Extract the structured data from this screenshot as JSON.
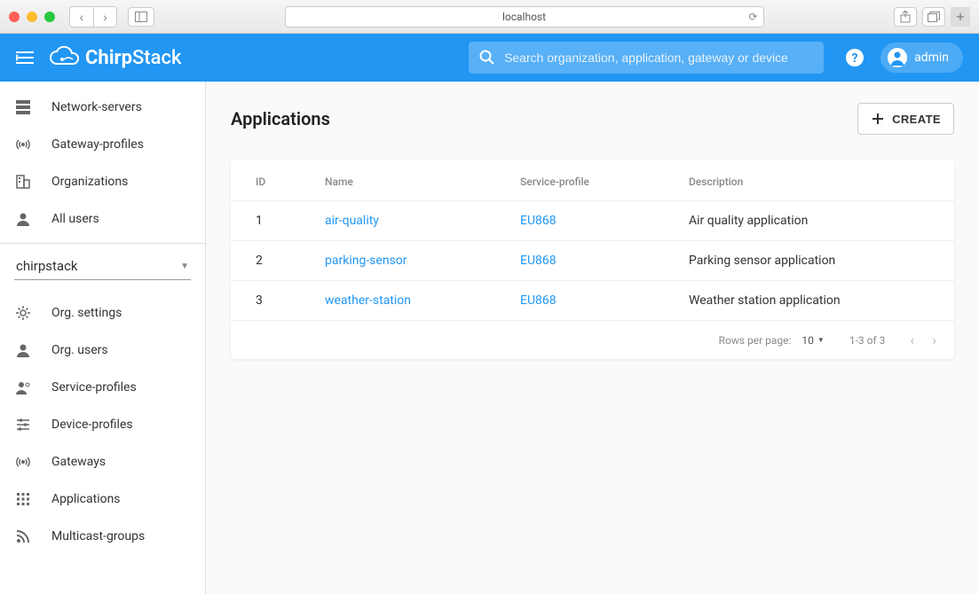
{
  "browser": {
    "url": "localhost"
  },
  "header": {
    "brand": "ChirpStack",
    "search_placeholder": "Search organization, application, gateway or device",
    "user": "admin"
  },
  "sidebar": {
    "top": [
      {
        "label": "Network-servers",
        "icon": "dns"
      },
      {
        "label": "Gateway-profiles",
        "icon": "antenna"
      },
      {
        "label": "Organizations",
        "icon": "building"
      },
      {
        "label": "All users",
        "icon": "person"
      }
    ],
    "org_selected": "chirpstack",
    "bottom": [
      {
        "label": "Org. settings",
        "icon": "gear"
      },
      {
        "label": "Org. users",
        "icon": "person"
      },
      {
        "label": "Service-profiles",
        "icon": "person-gear"
      },
      {
        "label": "Device-profiles",
        "icon": "sliders"
      },
      {
        "label": "Gateways",
        "icon": "antenna"
      },
      {
        "label": "Applications",
        "icon": "apps"
      },
      {
        "label": "Multicast-groups",
        "icon": "rss"
      }
    ]
  },
  "page": {
    "title": "Applications",
    "create_label": "CREATE",
    "columns": {
      "id": "ID",
      "name": "Name",
      "sp": "Service-profile",
      "desc": "Description"
    },
    "rows": [
      {
        "id": "1",
        "name": "air-quality",
        "sp": "EU868",
        "desc": "Air quality application"
      },
      {
        "id": "2",
        "name": "parking-sensor",
        "sp": "EU868",
        "desc": "Parking sensor application"
      },
      {
        "id": "3",
        "name": "weather-station",
        "sp": "EU868",
        "desc": "Weather station application"
      }
    ],
    "footer": {
      "rpp_label": "Rows per page:",
      "rpp_value": "10",
      "range": "1-3 of 3"
    }
  }
}
